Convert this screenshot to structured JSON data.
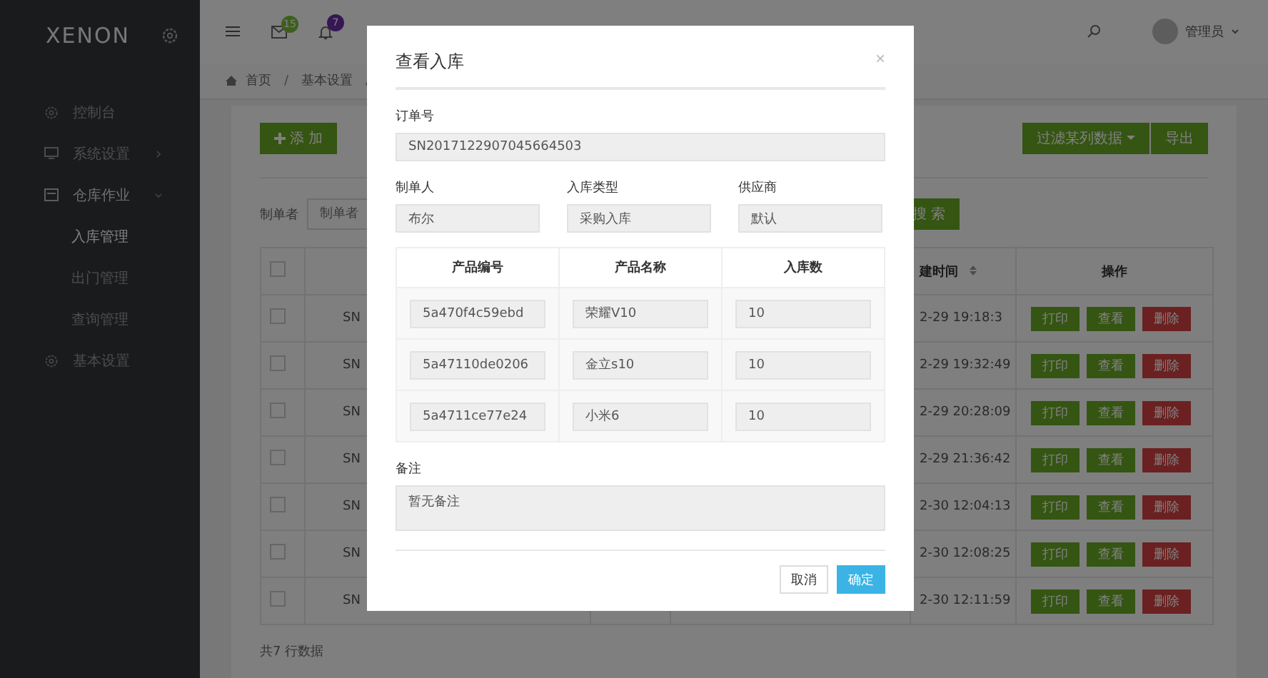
{
  "topbar": {
    "logo": "XENON",
    "mail_badge": "15",
    "bell_badge": "7",
    "user": "管理员"
  },
  "sidebar": {
    "items": [
      {
        "label": "控制台",
        "kind": "plain",
        "expanded": false
      },
      {
        "label": "系统设置",
        "kind": "group",
        "expanded": false
      },
      {
        "label": "仓库作业",
        "kind": "group",
        "expanded": true,
        "children": [
          {
            "label": "入库管理",
            "selected": true
          },
          {
            "label": "出门管理",
            "selected": false
          },
          {
            "label": "查询管理",
            "selected": false
          }
        ]
      },
      {
        "label": "基本设置",
        "kind": "plain",
        "expanded": false
      }
    ]
  },
  "breadcrumb": {
    "items": [
      "首页",
      "基本设置"
    ],
    "separator": "/"
  },
  "toolbar": {
    "add": "添 加",
    "filter": "过滤某列数据",
    "export": "导出"
  },
  "search": {
    "label": "制单者",
    "placeholder": "制单者",
    "button": "搜 索"
  },
  "table": {
    "columns": [
      "建时间",
      "操作"
    ],
    "header_checked": false,
    "rows": [
      {
        "checked": false,
        "sn": "SN",
        "time": "2-29 19:18:3",
        "actions": [
          "打印",
          "查看",
          "删除"
        ]
      },
      {
        "checked": false,
        "sn": "SN",
        "time": "2-29 19:32:49",
        "actions": [
          "打印",
          "查看",
          "删除"
        ]
      },
      {
        "checked": false,
        "sn": "SN",
        "time": "2-29 20:28:09",
        "actions": [
          "打印",
          "查看",
          "删除"
        ]
      },
      {
        "checked": false,
        "sn": "SN",
        "time": "2-29 21:36:42",
        "actions": [
          "打印",
          "查看",
          "删除"
        ]
      },
      {
        "checked": false,
        "sn": "SN",
        "time": "2-30 12:04:13",
        "actions": [
          "打印",
          "查看",
          "删除"
        ]
      },
      {
        "checked": false,
        "sn": "SN",
        "time": "2-30 12:08:25",
        "actions": [
          "打印",
          "查看",
          "删除"
        ]
      },
      {
        "checked": false,
        "sn": "SN",
        "time": "2-30 12:11:59",
        "actions": [
          "打印",
          "查看",
          "删除"
        ]
      }
    ],
    "footer": "共7 行数据"
  },
  "modal": {
    "title": "查看入库",
    "close": "×",
    "order": {
      "label": "订单号",
      "value": "SN2017122907045664503"
    },
    "fields": [
      {
        "label": "制单人",
        "value": "布尔"
      },
      {
        "label": "入库类型",
        "value": "采购入库"
      },
      {
        "label": "供应商",
        "value": "默认"
      }
    ],
    "products": {
      "columns": [
        "产品编号",
        "产品名称",
        "入库数"
      ],
      "rows": [
        [
          "5a470f4c59ebd",
          "荣耀V10",
          "10"
        ],
        [
          "5a47110de0206",
          "金立s10",
          "10"
        ],
        [
          "5a4711ce77e24",
          "小米6",
          "10"
        ]
      ]
    },
    "note": {
      "label": "备注",
      "value": "暂无备注"
    },
    "buttons": [
      "取消",
      "确定"
    ]
  }
}
